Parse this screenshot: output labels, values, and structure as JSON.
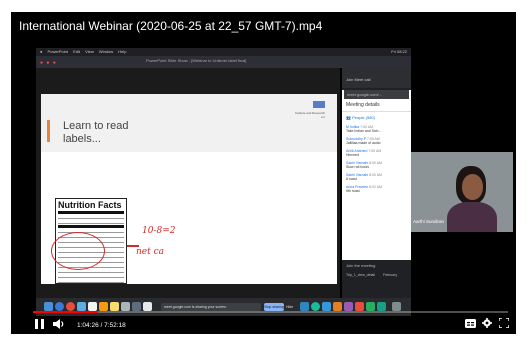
{
  "video": {
    "title": "International Webinar (2020-06-25 at 22_57 GMT-7).mp4",
    "current_time": "1:04:26",
    "duration": "7:52:18",
    "time_display": "1:04:26 / 7:52:18",
    "progress_fraction": 0.136,
    "progress_color": "#ff0000"
  },
  "mac_menubar": {
    "items": [
      "PowerPoint",
      "Edit",
      "View",
      "Window",
      "Help"
    ],
    "status": "Fri 08:22"
  },
  "powerpoint": {
    "document_title": "PowerPoint Slide Show - [Webinar to Unilever label final]"
  },
  "slide": {
    "title": "Learn to read labels...",
    "accent_color": "#e8833a",
    "logo_line1": "Institute and Research",
    "logo_line2": "Ltd",
    "label_heading": "Nutrition Facts",
    "annotation_line1": "10-8=2",
    "annotation_line2": "net ca",
    "annotation_color": "#d62a2a"
  },
  "chrome": {
    "tab_label": "Join Meet call",
    "url": "meet.google.com/..."
  },
  "meet": {
    "header": "Meeting details",
    "people_label": "People (580)",
    "messages": [
      {
        "name": "M Indika",
        "time": "7:50 AM",
        "text": "Take Indian and Sich..."
      },
      {
        "name": "Sukruddhy P",
        "time": "7:50 AM",
        "text": "Jaliillaa made of audio"
      },
      {
        "name": "Aniik Ahamed",
        "time": "7:50 AM",
        "text": "Himmed"
      },
      {
        "name": "Sakhi Vismahi",
        "time": "8:00 AM",
        "text": "Slow roti foods"
      },
      {
        "name": "Sakhi Vismahi",
        "time": "8:00 AM",
        "text": "6 roast"
      },
      {
        "name": "Anna Praveen",
        "time": "8:02 AM",
        "text": "9th roast"
      }
    ],
    "footer_left": "Join the meeting",
    "footer_cells": [
      "Trip_1_view_detail",
      "February"
    ]
  },
  "webcam": {
    "participant_name": "Aarthi Sundiran"
  },
  "dock": {
    "share_text": "meet.google.com is sharing your screen.",
    "stop_label": "Stop sharing",
    "hide_label": "Hide"
  },
  "controls": {
    "play_icon": "pause-icon",
    "volume_icon": "volume-icon",
    "subtitles_icon": "subtitles-icon",
    "settings_icon": "gear-icon",
    "fullscreen_icon": "fullscreen-icon"
  }
}
